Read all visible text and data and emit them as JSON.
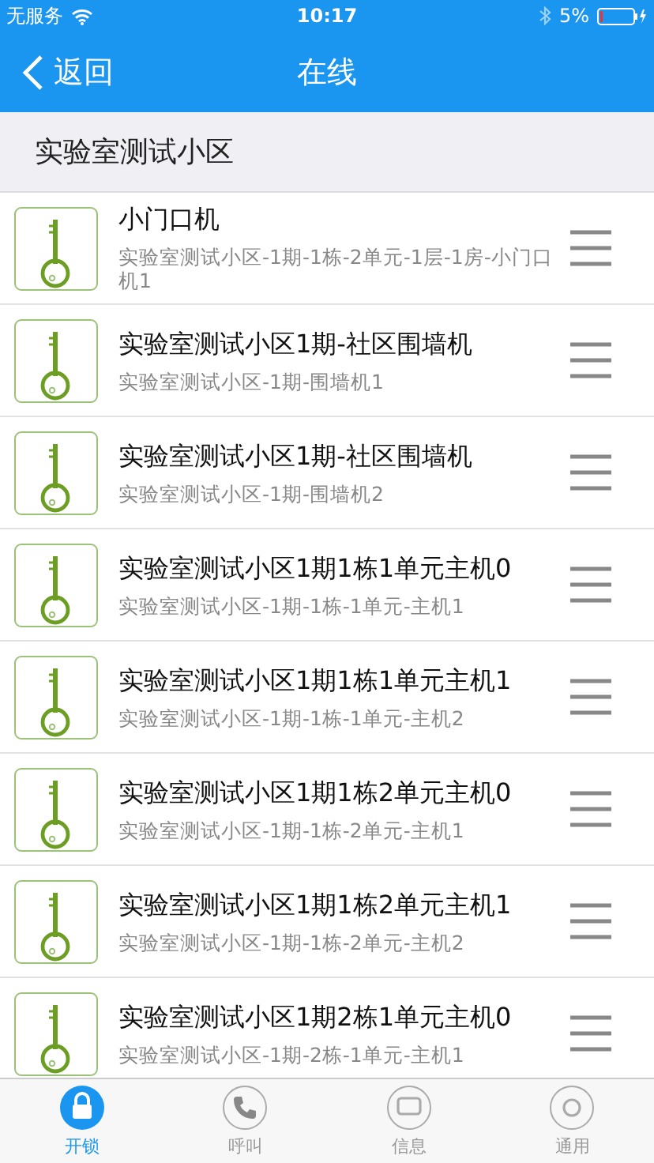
{
  "status_bar": {
    "carrier": "无服务",
    "time": "10:17",
    "battery": "5%"
  },
  "nav": {
    "back": "返回",
    "title": "在线"
  },
  "section": {
    "title": "实验室测试小区"
  },
  "devices": [
    {
      "name": "小门口机",
      "address": "实验室测试小区-1期-1栋-2单元-1层-1房-小门口机1"
    },
    {
      "name": "实验室测试小区1期-社区围墙机",
      "address": "实验室测试小区-1期-围墙机1"
    },
    {
      "name": "实验室测试小区1期-社区围墙机",
      "address": "实验室测试小区-1期-围墙机2"
    },
    {
      "name": "实验室测试小区1期1栋1单元主机0",
      "address": "实验室测试小区-1期-1栋-1单元-主机1"
    },
    {
      "name": "实验室测试小区1期1栋1单元主机1",
      "address": "实验室测试小区-1期-1栋-1单元-主机2"
    },
    {
      "name": "实验室测试小区1期1栋2单元主机0",
      "address": "实验室测试小区-1期-1栋-2单元-主机1"
    },
    {
      "name": "实验室测试小区1期1栋2单元主机1",
      "address": "实验室测试小区-1期-1栋-2单元-主机2"
    },
    {
      "name": "实验室测试小区1期2栋1单元主机0",
      "address": "实验室测试小区-1期-2栋-1单元-主机1"
    }
  ],
  "tabs": [
    {
      "label": "开锁",
      "kind": "lock",
      "selected": true
    },
    {
      "label": "呼叫",
      "kind": "phone",
      "selected": false
    },
    {
      "label": "信息",
      "kind": "message",
      "selected": false
    },
    {
      "label": "通用",
      "kind": "general",
      "selected": false
    }
  ]
}
